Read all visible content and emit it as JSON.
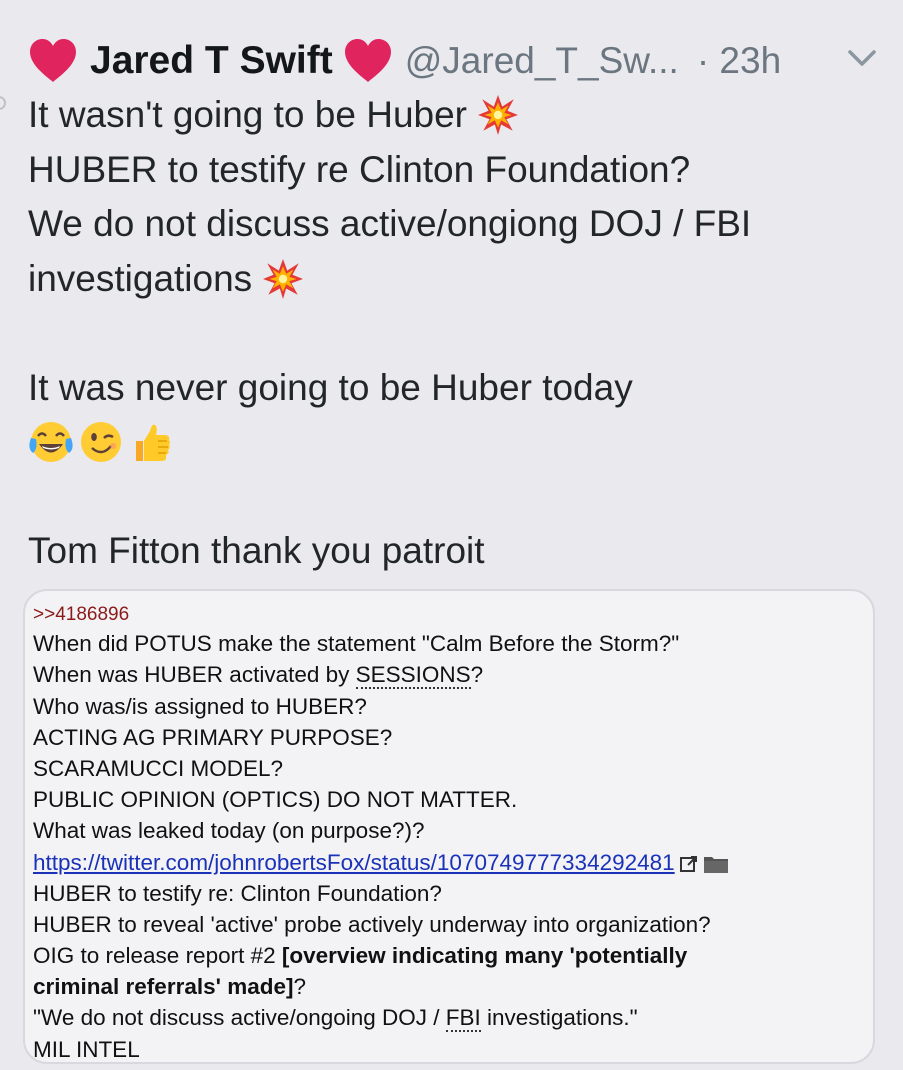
{
  "tweet": {
    "display_name": "Jared T Swift",
    "handle": "@Jared_T_Sw...",
    "time": "· 23h",
    "lines": [
      "It wasn't going to be Huber",
      "HUBER to testify re Clinton Foundation?",
      "We do not discuss active/ongiong DOJ / FBI",
      "investigations",
      "It was never going to be Huber today",
      "Tom Fitton thank you patroit"
    ],
    "emojis": [
      "face-with-tears-of-joy-icon",
      "winking-face-icon",
      "thumbs-up-icon"
    ]
  },
  "card": {
    "ref": ">>4186896",
    "line1": "When did POTUS make the statement \"Calm Before the Storm?\"",
    "line2_prefix": "When was HUBER activated by ",
    "line2_underlined": "SESSIONS",
    "line2_suffix": "?",
    "line3": "Who was/is assigned to HUBER?",
    "line4": "ACTING AG PRIMARY PURPOSE?",
    "line5": "SCARAMUCCI MODEL?",
    "line6": "PUBLIC OPINION (OPTICS) DO NOT MATTER.",
    "line7": "What was leaked today (on purpose?)?",
    "link": "https://twitter.com/johnrobertsFox/status/1070749777334292481",
    "line9": "HUBER to testify re: Clinton Foundation?",
    "line10": "HUBER to reveal 'active' probe actively underway into organization?",
    "line11_prefix": "OIG to release report #2 ",
    "line11_bold": "[overview indicating many 'potentially",
    "line12_bold": "criminal referrals' made]",
    "line12_suffix": "?",
    "line13_prefix": "\"We do not discuss active/ongoing DOJ / ",
    "line13_underlined": "FBI",
    "line13_suffix": " investigations.\"",
    "line14_underlined": "MIL",
    "line14_suffix": " INTEL"
  },
  "colors": {
    "background": "#e9e9ee",
    "heart": "#e0245e",
    "muted": "#6b7680",
    "link": "#1a32b8",
    "ref": "#8b1a1a"
  }
}
